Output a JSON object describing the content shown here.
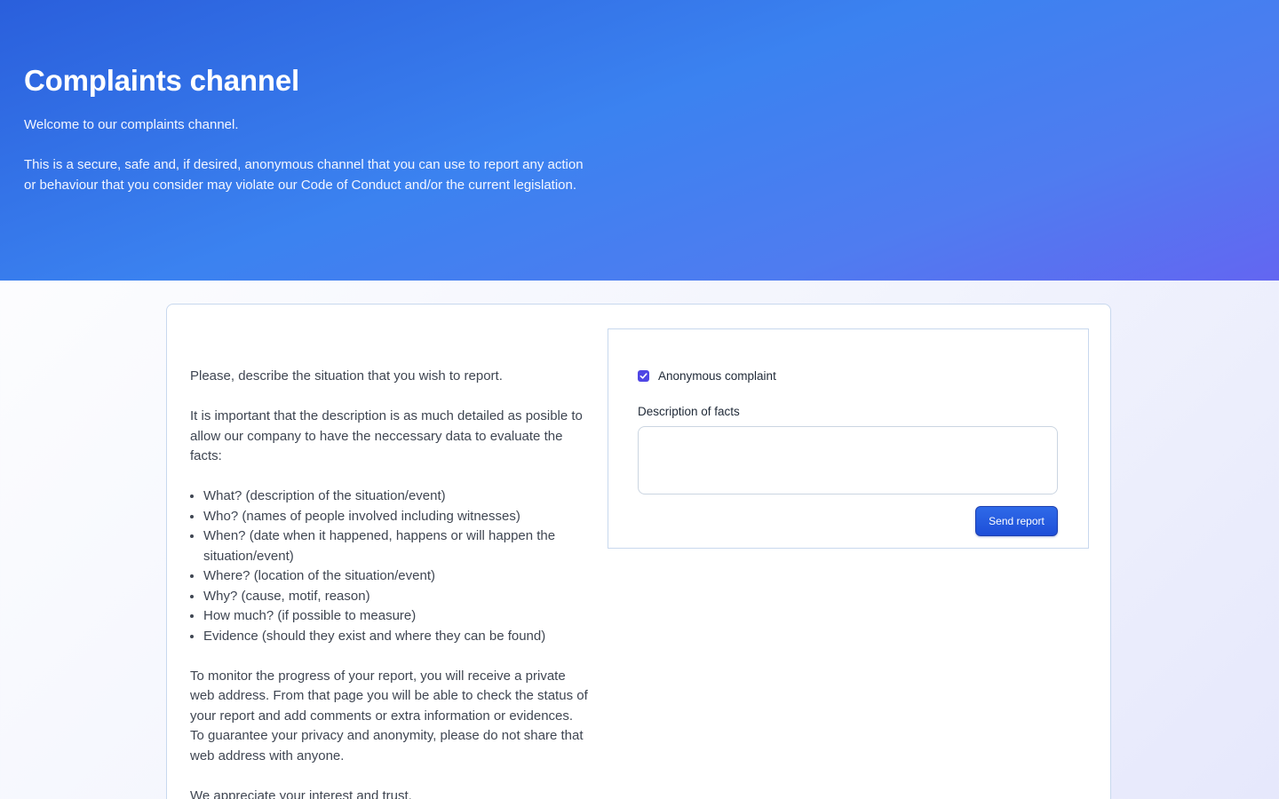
{
  "header": {
    "title": "Complaints channel",
    "intro": [
      "Welcome to our complaints channel.",
      "This is a secure, safe and, if desired, anonymous channel that you can use to report any action or behaviour that you consider may violate our Code of Conduct and/or the current legislation."
    ]
  },
  "instructions": {
    "lead": "Please, describe the situation that you wish to report.",
    "detail": "It is important that the description is as much detailed as posible to allow our company to have the neccessary data to evaluate the facts:",
    "items": [
      "What? (description of the situation/event)",
      "Who? (names of people involved including witnesses)",
      "When? (date when it happened, happens or will happen the situation/event)",
      "Where? (location of the situation/event)",
      "Why? (cause, motif, reason)",
      "How much? (if possible to measure)",
      "Evidence (should they exist and where they can be found)"
    ],
    "monitor": "To monitor the progress of your report, you will receive a private web address. From that page you will be able to check the status of your report and add comments or extra information or evidences. To guarantee your privacy and anonymity, please do not share that web address with anyone.",
    "closing": "We appreciate your interest and trust."
  },
  "form": {
    "anonymous_label": "Anonymous complaint",
    "anonymous_checked": true,
    "description_label": "Description of facts",
    "description_value": "",
    "submit_label": "Send report"
  },
  "colors": {
    "accent": "#4f46e5",
    "button": "#1d4ed8",
    "hero_start": "#2a5fdc",
    "hero_end": "#6366f1"
  }
}
